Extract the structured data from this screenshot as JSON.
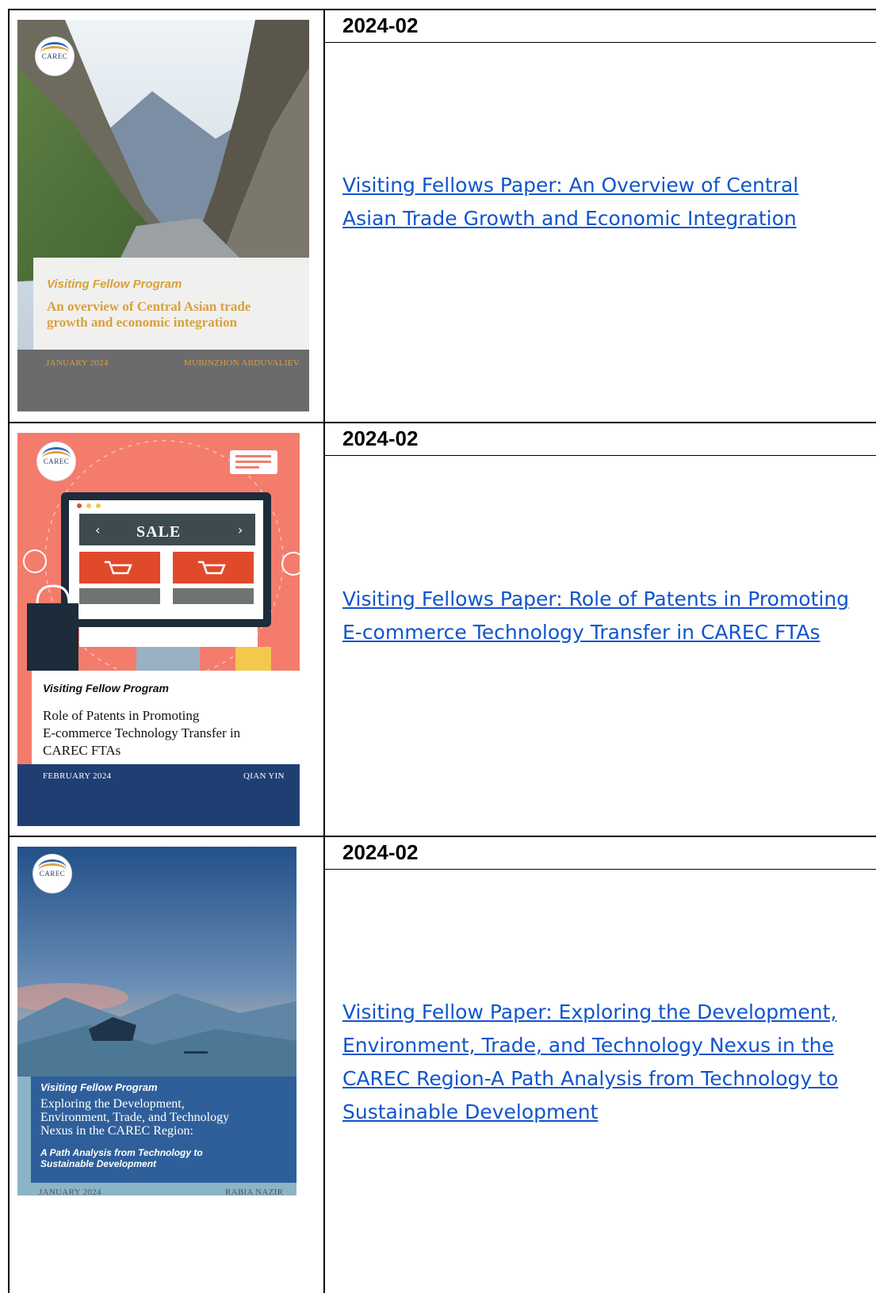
{
  "rows": [
    {
      "date": "2024-02",
      "link_lines": [
        "Visiting Fellows Paper: An Overview of Central",
        "Asian Trade Growth and Economic Integration"
      ],
      "cover": {
        "logo": "CAREC",
        "program": "Visiting Fellow Program",
        "title_lines": [
          "An overview of Central Asian trade",
          "growth and economic integration"
        ],
        "footer_left": "JANUARY 2024",
        "footer_right": "MUBINZHON ABDUVALIEV"
      }
    },
    {
      "date": "2024-02",
      "link_lines": [
        "Visiting Fellows Paper: Role of Patents in Promoting",
        "E-commerce Technology Transfer in CAREC FTAs"
      ],
      "cover": {
        "logo": "CAREC",
        "banner": "SALE",
        "program": "Visiting Fellow Program",
        "title_lines": [
          "Role of Patents in Promoting",
          "E-commerce Technology Transfer in",
          "CAREC FTAs"
        ],
        "footer_left": "FEBRUARY 2024",
        "footer_right": "QIAN YIN"
      }
    },
    {
      "date": "2024-02",
      "link_lines": [
        "Visiting Fellow Paper: Exploring the Development,",
        "Environment, Trade, and Technology Nexus in the",
        "CAREC Region-A Path Analysis from Technology to",
        "Sustainable Development"
      ],
      "cover": {
        "logo": "CAREC",
        "program": "Visiting Fellow Program",
        "title_lines": [
          "Exploring the Development,",
          "Environment, Trade, and Technology",
          "Nexus in the CAREC Region:"
        ],
        "subtitle_lines": [
          "A Path Analysis from Technology to",
          "Sustainable Development"
        ],
        "footer_left": "JANUARY 2024",
        "footer_right": "RABIA NAZIR"
      }
    }
  ],
  "colors": {
    "link": "#1155cc",
    "cover1_panel_text": "#d9a13a",
    "cover2_bg": "#f47c6c",
    "cover2_footer": "#1f3f73",
    "cover3_panel": "#2f5f9a"
  }
}
